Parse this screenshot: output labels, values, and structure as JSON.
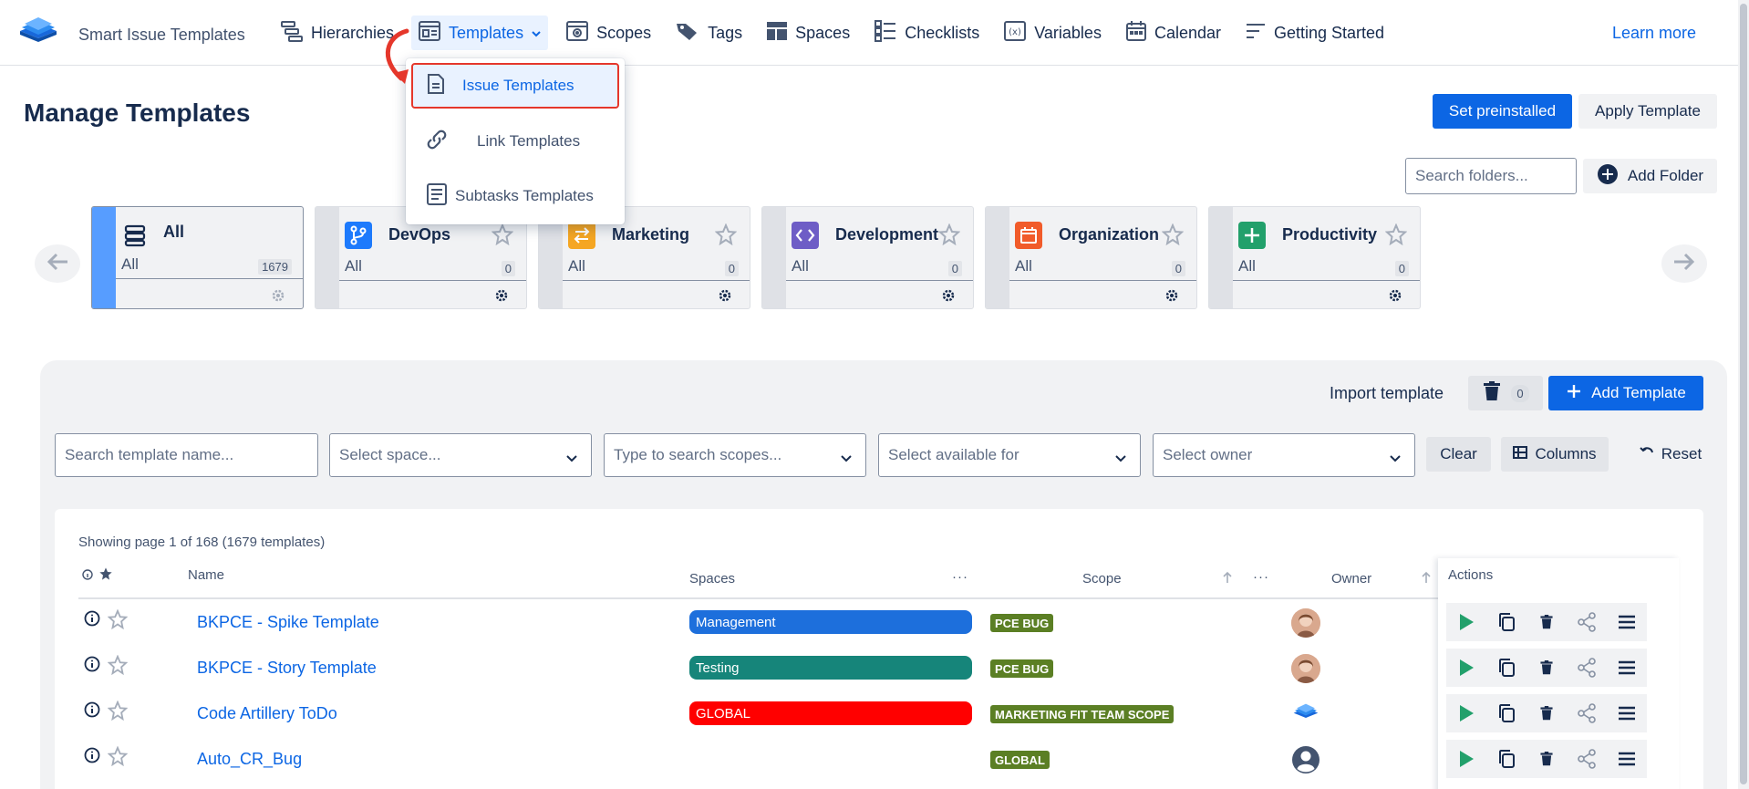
{
  "app": {
    "brand_name": "Smart Issue Templates",
    "learn_more": "Learn more"
  },
  "nav": {
    "items": [
      {
        "label": "Hierarchies",
        "icon": "hierarchy-icon"
      },
      {
        "label": "Templates",
        "icon": "template-icon",
        "active": true
      },
      {
        "label": "Scopes",
        "icon": "scope-icon"
      },
      {
        "label": "Tags",
        "icon": "tag-icon"
      },
      {
        "label": "Spaces",
        "icon": "spaces-icon"
      },
      {
        "label": "Checklists",
        "icon": "checklist-icon"
      },
      {
        "label": "Variables",
        "icon": "variable-icon"
      },
      {
        "label": "Calendar",
        "icon": "calendar-icon"
      },
      {
        "label": "Getting Started",
        "icon": "getting-started-icon"
      }
    ]
  },
  "templates_menu": {
    "items": [
      {
        "label": "Issue Templates",
        "icon": "document-icon",
        "selected": true
      },
      {
        "label": "Link Templates",
        "icon": "link-icon"
      },
      {
        "label": "Subtasks Templates",
        "icon": "subtasks-icon"
      }
    ]
  },
  "page": {
    "title": "Manage Templates",
    "set_preinstalled": "Set preinstalled",
    "apply_template": "Apply Template",
    "search_folders_placeholder": "Search folders...",
    "add_folder": "Add Folder"
  },
  "folders": [
    {
      "name": "All",
      "sub": "All",
      "count": "1679",
      "icon": "stack-icon",
      "color": "",
      "active": true
    },
    {
      "name": "DevOps",
      "sub": "All",
      "count": "0",
      "icon": "branch-icon",
      "color": "#1d7afc"
    },
    {
      "name": "Marketing",
      "sub": "All",
      "count": "0",
      "icon": "swap-icon",
      "color": "#f5a623"
    },
    {
      "name": "Development",
      "sub": "All",
      "count": "0",
      "icon": "code-icon",
      "color": "#6e5dc6"
    },
    {
      "name": "Organization",
      "sub": "All",
      "count": "0",
      "icon": "calendar-icon",
      "color": "#f15b2a"
    },
    {
      "name": "Productivity",
      "sub": "All",
      "count": "0",
      "icon": "plus-icon",
      "color": "#22a06b"
    }
  ],
  "toolbar": {
    "import_template": "Import template",
    "trash_count": "0",
    "add_template": "Add Template"
  },
  "filters": {
    "search_name_placeholder": "Search template name...",
    "space_placeholder": "Select space...",
    "scopes_placeholder": "Type to search scopes...",
    "available_for_placeholder": "Select available for",
    "owner_placeholder": "Select owner",
    "clear": "Clear",
    "columns": "Columns",
    "reset": "Reset"
  },
  "table": {
    "showing": "Showing page 1 of 168 (1679 templates)",
    "headers": {
      "name": "Name",
      "spaces": "Spaces",
      "scope": "Scope",
      "owner": "Owner",
      "actions": "Actions"
    },
    "rows": [
      {
        "name": "BKPCE - Spike Template",
        "space": "Management",
        "space_color": "#1d6fdc",
        "scope": "PCE BUG",
        "owner": "avatar-photo"
      },
      {
        "name": "BKPCE - Story Template",
        "space": "Testing",
        "space_color": "#16857a",
        "scope": "PCE BUG",
        "owner": "avatar-photo"
      },
      {
        "name": "Code Artillery ToDo",
        "space": "GLOBAL",
        "space_color": "#ff0000",
        "scope": "MARKETING FIT TEAM SCOPE",
        "owner": "app-logo"
      },
      {
        "name": "Auto_CR_Bug",
        "space": "",
        "space_color": "",
        "scope": "GLOBAL",
        "owner": "default-avatar"
      }
    ]
  },
  "colors": {
    "primary": "#0c66e4",
    "scope_badge": "#5b7f24",
    "annotation_red": "#e5372b"
  }
}
